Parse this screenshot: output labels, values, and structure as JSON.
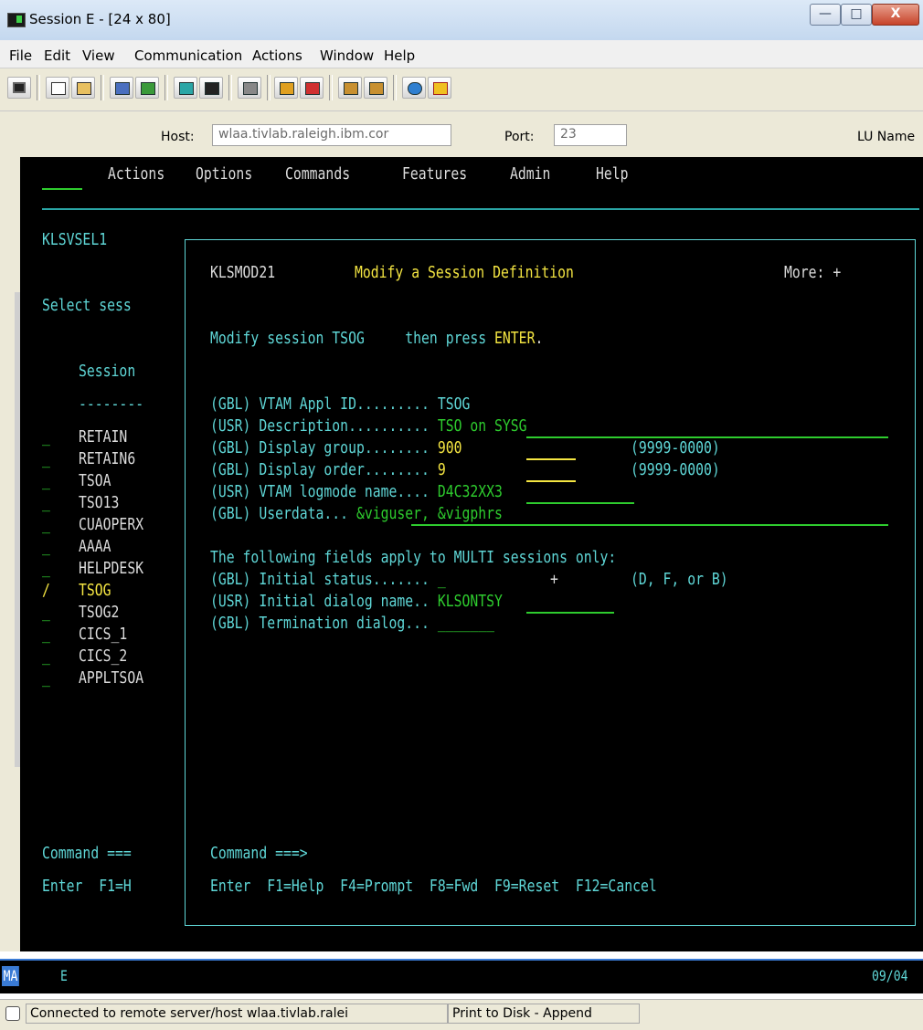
{
  "window": {
    "title": "Session E - [24 x 80]",
    "buttons": {
      "minimize": "—",
      "maximize": "□",
      "close": "X"
    }
  },
  "menu": [
    "File",
    "Edit",
    "View",
    "Communication",
    "Actions",
    "Window",
    "Help"
  ],
  "hostbar": {
    "host_label": "Host:",
    "host_value": "wlaa.tivlab.raleigh.ibm.cor",
    "port_label": "Port:",
    "port_value": "23",
    "lu_label": "LU Name"
  },
  "terminal": {
    "action_bar": [
      "Actions",
      "Options",
      "Commands",
      "Features",
      "Admin",
      "Help"
    ],
    "panel_id": "KLSVSEL1",
    "select_prompt": "Select sess",
    "session_header": "Session",
    "session_rule": "--------",
    "sessions": [
      {
        "select": "_",
        "name": "RETAIN"
      },
      {
        "select": "_",
        "name": "RETAIN6"
      },
      {
        "select": "_",
        "name": "TSOA"
      },
      {
        "select": "_",
        "name": "TSO13"
      },
      {
        "select": "_",
        "name": "CUAOPERX"
      },
      {
        "select": "_",
        "name": "AAAA"
      },
      {
        "select": "_",
        "name": "HELPDESK"
      },
      {
        "select": "/",
        "name": "TSOG"
      },
      {
        "select": "_",
        "name": "TSOG2"
      },
      {
        "select": "_",
        "name": "CICS_1"
      },
      {
        "select": "_",
        "name": "CICS_2"
      },
      {
        "select": "_",
        "name": "APPLTSOA"
      }
    ],
    "command_left": "Command ===",
    "keys_left": "Enter  F1=H",
    "dialog": {
      "id": "KLSMOD21",
      "title": "Modify a Session Definition",
      "more": "More: +",
      "instr_prefix": "Modify session TSOG     then press ",
      "instr_enter": "ENTER",
      "instr_suffix": ".",
      "fields": {
        "vtam_label": "(GBL) VTAM Appl ID......... ",
        "vtam_value": "TSOG",
        "desc_label": "(USR) Description.......... ",
        "desc_value": "TSO on SYSG",
        "dgroup_label": "(GBL) Display group........ ",
        "dgroup_value": "900",
        "dgroup_range": "(9999-0000)",
        "dorder_label": "(GBL) Display order........ ",
        "dorder_value": "9",
        "dorder_range": "(9999-0000)",
        "logmode_label": "(USR) VTAM logmode name.... ",
        "logmode_value": "D4C32XX3",
        "userdata_label": "(GBL) Userdata... ",
        "userdata_value": "&viguser, &vigphrs",
        "multi_note": "The following fields apply to MULTI sessions only:",
        "initstat_label": "(GBL) Initial status....... ",
        "initstat_value": "_",
        "initstat_plus": "+",
        "initstat_options": "(D, F, or B)",
        "initdlg_label": "(USR) Initial dialog name.. ",
        "initdlg_value": "KLSONTSY",
        "termdlg_label": "(GBL) Termination dialog... ",
        "termdlg_value": "_______"
      },
      "command": "Command ===>",
      "keys": "Enter  F1=Help  F4=Prompt  F8=Fwd  F9=Reset  F12=Cancel"
    }
  },
  "oia": {
    "left": "MA",
    "mid": "E",
    "right": "09/04"
  },
  "statusbar": {
    "connection": "Connected to remote server/host wlaa.tivlab.ralei",
    "print": "Print to Disk - Append"
  },
  "colors": {
    "terminal_bg": "#000000",
    "cyan": "#5fd7d7",
    "green": "#2ecc2e",
    "yellow": "#f5e642"
  }
}
